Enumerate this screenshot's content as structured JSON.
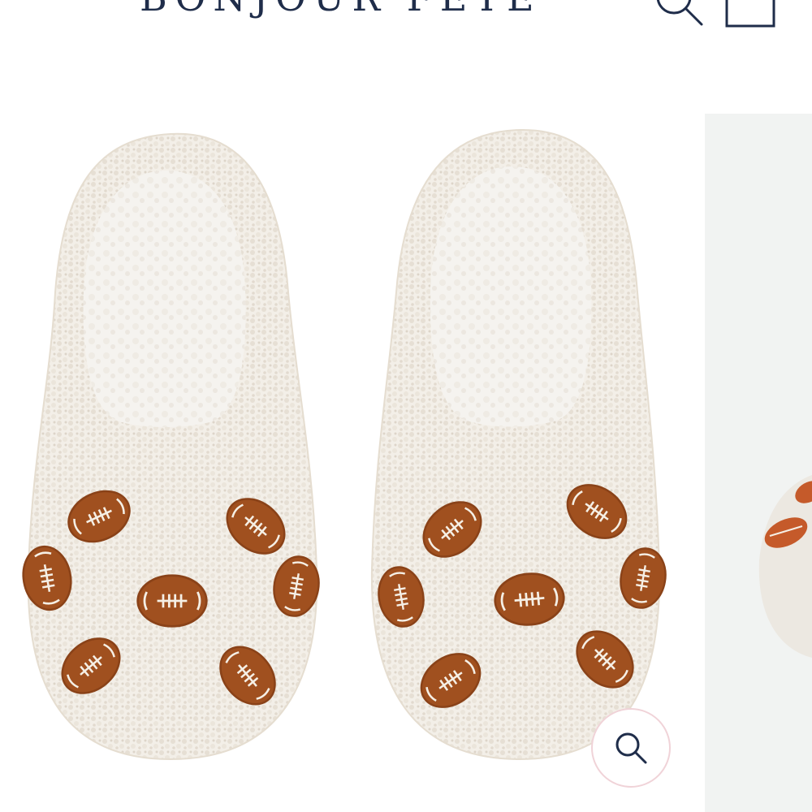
{
  "header": {
    "brand": "BONJOUR FETE",
    "search_icon": "search-icon",
    "cart_icon": "cart-icon"
  },
  "gallery": {
    "main_image": "football-slippers",
    "next_image": "football-slipper-partial",
    "zoom_icon": "zoom-icon"
  },
  "colors": {
    "brand_navy": "#1f2d4a",
    "zoom_border": "#f0d3d8",
    "sherpa": "#f3efe8",
    "football": "#a0501f"
  }
}
